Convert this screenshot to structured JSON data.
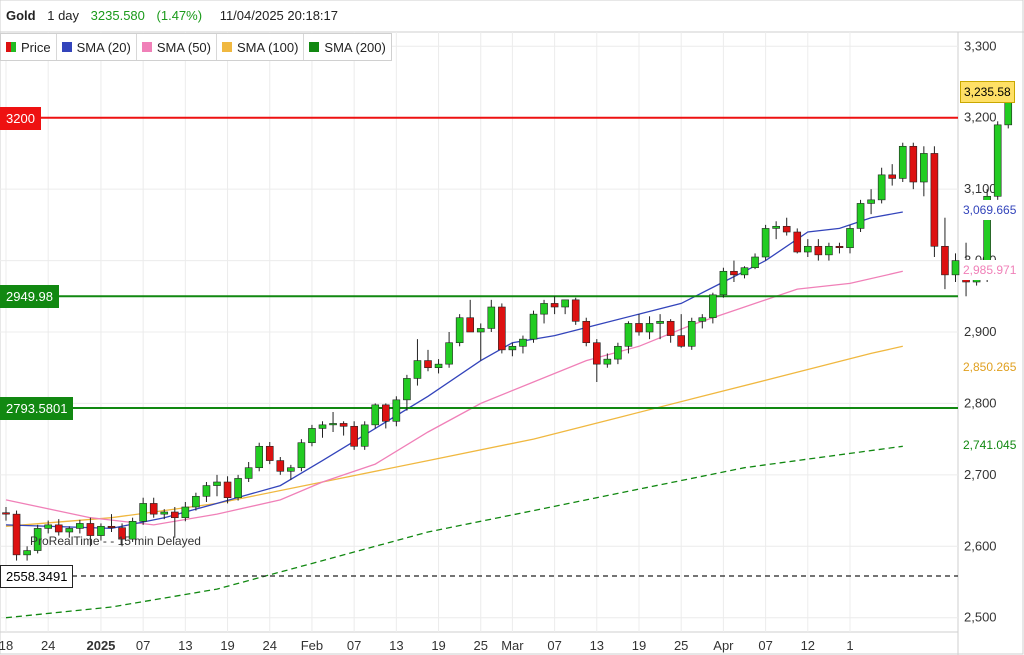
{
  "header": {
    "symbol": "Gold",
    "timeframe": "1 day",
    "price": "3235.580",
    "change": "(1.47%)",
    "datetime": "11/04/2025 20:18:17"
  },
  "legend": [
    {
      "label": "Price",
      "color": "#22bb22"
    },
    {
      "label": "SMA (20)",
      "color": "#3344bb"
    },
    {
      "label": "SMA (50)",
      "color": "#f080b8"
    },
    {
      "label": "SMA (100)",
      "color": "#f0b840"
    },
    {
      "label": "SMA (200)",
      "color": "#118811"
    }
  ],
  "footer_note": "ProRealTime -     - 15 min Delayed",
  "chart_data": {
    "type": "candlestick",
    "title": "Gold",
    "y_range": [
      2480,
      3320
    ],
    "y_ticks": [
      "2,500",
      "2,600",
      "2,700",
      "2,800",
      "2,900",
      "3,000",
      "3,100",
      "3,200",
      "3,300"
    ],
    "y_tick_values": [
      2500,
      2600,
      2700,
      2800,
      2900,
      3000,
      3100,
      3200,
      3300
    ],
    "x_tick_labels": [
      "18",
      "24",
      "2025",
      "07",
      "13",
      "19",
      "24",
      "Feb",
      "07",
      "13",
      "19",
      "25",
      "Mar",
      "07",
      "13",
      "19",
      "25",
      "Apr",
      "07",
      "12",
      "1"
    ],
    "x_tick_index": [
      0,
      4,
      9,
      13,
      17,
      21,
      25,
      29,
      33,
      37,
      41,
      45,
      48,
      52,
      56,
      60,
      64,
      68,
      72,
      76,
      80
    ],
    "candles": [
      [
        2647,
        2655,
        2636,
        2645
      ],
      [
        2645,
        2650,
        2580,
        2588
      ],
      [
        2588,
        2600,
        2580,
        2594
      ],
      [
        2594,
        2630,
        2590,
        2625
      ],
      [
        2625,
        2636,
        2618,
        2630
      ],
      [
        2630,
        2638,
        2615,
        2620
      ],
      [
        2620,
        2628,
        2612,
        2625
      ],
      [
        2625,
        2637,
        2618,
        2632
      ],
      [
        2632,
        2640,
        2600,
        2615
      ],
      [
        2615,
        2632,
        2608,
        2628
      ],
      [
        2628,
        2645,
        2620,
        2626
      ],
      [
        2626,
        2632,
        2600,
        2610
      ],
      [
        2610,
        2640,
        2606,
        2635
      ],
      [
        2635,
        2668,
        2630,
        2660
      ],
      [
        2660,
        2668,
        2640,
        2645
      ],
      [
        2645,
        2652,
        2638,
        2648
      ],
      [
        2648,
        2655,
        2612,
        2640
      ],
      [
        2640,
        2662,
        2635,
        2655
      ],
      [
        2655,
        2675,
        2650,
        2670
      ],
      [
        2670,
        2690,
        2662,
        2685
      ],
      [
        2685,
        2700,
        2670,
        2690
      ],
      [
        2690,
        2698,
        2660,
        2668
      ],
      [
        2668,
        2700,
        2664,
        2695
      ],
      [
        2695,
        2718,
        2690,
        2710
      ],
      [
        2710,
        2745,
        2705,
        2740
      ],
      [
        2740,
        2746,
        2715,
        2720
      ],
      [
        2720,
        2725,
        2700,
        2705
      ],
      [
        2705,
        2714,
        2693,
        2710
      ],
      [
        2710,
        2750,
        2705,
        2745
      ],
      [
        2745,
        2770,
        2740,
        2765
      ],
      [
        2765,
        2775,
        2752,
        2770
      ],
      [
        2770,
        2788,
        2760,
        2772
      ],
      [
        2772,
        2775,
        2755,
        2768
      ],
      [
        2768,
        2775,
        2735,
        2740
      ],
      [
        2740,
        2775,
        2735,
        2770
      ],
      [
        2770,
        2800,
        2765,
        2798
      ],
      [
        2798,
        2800,
        2765,
        2775
      ],
      [
        2775,
        2810,
        2768,
        2805
      ],
      [
        2805,
        2840,
        2790,
        2835
      ],
      [
        2835,
        2890,
        2825,
        2860
      ],
      [
        2860,
        2875,
        2845,
        2850
      ],
      [
        2850,
        2862,
        2842,
        2855
      ],
      [
        2855,
        2900,
        2850,
        2885
      ],
      [
        2885,
        2925,
        2880,
        2920
      ],
      [
        2920,
        2945,
        2910,
        2900
      ],
      [
        2900,
        2912,
        2860,
        2905
      ],
      [
        2905,
        2945,
        2900,
        2935
      ],
      [
        2935,
        2940,
        2870,
        2875
      ],
      [
        2875,
        2885,
        2866,
        2880
      ],
      [
        2880,
        2895,
        2870,
        2890
      ],
      [
        2890,
        2930,
        2885,
        2925
      ],
      [
        2925,
        2945,
        2912,
        2940
      ],
      [
        2940,
        2950,
        2925,
        2935
      ],
      [
        2935,
        2945,
        2925,
        2945
      ],
      [
        2945,
        2948,
        2910,
        2915
      ],
      [
        2915,
        2920,
        2880,
        2885
      ],
      [
        2885,
        2890,
        2830,
        2855
      ],
      [
        2855,
        2870,
        2850,
        2862
      ],
      [
        2862,
        2885,
        2855,
        2880
      ],
      [
        2880,
        2915,
        2870,
        2912
      ],
      [
        2912,
        2925,
        2895,
        2900
      ],
      [
        2900,
        2922,
        2890,
        2912
      ],
      [
        2912,
        2925,
        2890,
        2915
      ],
      [
        2915,
        2918,
        2885,
        2895
      ],
      [
        2895,
        2925,
        2878,
        2880
      ],
      [
        2880,
        2920,
        2875,
        2915
      ],
      [
        2915,
        2925,
        2905,
        2920
      ],
      [
        2920,
        2955,
        2912,
        2952
      ],
      [
        2952,
        2990,
        2948,
        2985
      ],
      [
        2985,
        3000,
        2970,
        2980
      ],
      [
        2980,
        2992,
        2975,
        2990
      ],
      [
        2990,
        3010,
        2988,
        3005
      ],
      [
        3005,
        3050,
        3000,
        3045
      ],
      [
        3045,
        3055,
        3030,
        3048
      ],
      [
        3048,
        3060,
        3035,
        3040
      ],
      [
        3040,
        3045,
        3010,
        3012
      ],
      [
        3012,
        3030,
        3005,
        3020
      ],
      [
        3020,
        3030,
        3000,
        3008
      ],
      [
        3008,
        3025,
        3000,
        3020
      ],
      [
        3020,
        3025,
        3010,
        3018
      ],
      [
        3018,
        3050,
        3010,
        3045
      ],
      [
        3045,
        3085,
        3040,
        3080
      ],
      [
        3080,
        3100,
        3065,
        3085
      ],
      [
        3085,
        3130,
        3080,
        3120
      ],
      [
        3120,
        3135,
        3105,
        3115
      ],
      [
        3115,
        3165,
        3110,
        3160
      ],
      [
        3160,
        3165,
        3100,
        3110
      ],
      [
        3110,
        3160,
        3090,
        3150
      ],
      [
        3150,
        3160,
        3005,
        3020
      ],
      [
        3020,
        3060,
        2960,
        2980
      ],
      [
        2980,
        3010,
        2970,
        3000
      ],
      [
        3000,
        3025,
        2950,
        2970
      ],
      [
        2970,
        3000,
        2965,
        2975
      ],
      [
        2975,
        3100,
        2970,
        3090
      ],
      [
        3090,
        3195,
        3085,
        3190
      ],
      [
        3190,
        3245,
        3185,
        3235
      ]
    ],
    "sma20": [
      [
        0,
        2630
      ],
      [
        10,
        2625
      ],
      [
        15,
        2640
      ],
      [
        20,
        2660
      ],
      [
        26,
        2685
      ],
      [
        30,
        2720
      ],
      [
        35,
        2765
      ],
      [
        40,
        2810
      ],
      [
        45,
        2860
      ],
      [
        48,
        2885
      ],
      [
        52,
        2895
      ],
      [
        56,
        2910
      ],
      [
        60,
        2925
      ],
      [
        64,
        2940
      ],
      [
        68,
        2970
      ],
      [
        72,
        3000
      ],
      [
        76,
        3040
      ],
      [
        79,
        3045
      ],
      [
        82,
        3060
      ],
      [
        85,
        3068
      ]
    ],
    "sma50": [
      [
        0,
        2665
      ],
      [
        8,
        2640
      ],
      [
        14,
        2630
      ],
      [
        20,
        2645
      ],
      [
        26,
        2665
      ],
      [
        30,
        2690
      ],
      [
        35,
        2715
      ],
      [
        40,
        2760
      ],
      [
        45,
        2800
      ],
      [
        50,
        2830
      ],
      [
        55,
        2860
      ],
      [
        60,
        2880
      ],
      [
        65,
        2910
      ],
      [
        70,
        2935
      ],
      [
        75,
        2960
      ],
      [
        80,
        2968
      ],
      [
        85,
        2985
      ]
    ],
    "sma100": [
      [
        0,
        2628
      ],
      [
        10,
        2640
      ],
      [
        20,
        2660
      ],
      [
        30,
        2690
      ],
      [
        40,
        2720
      ],
      [
        50,
        2750
      ],
      [
        58,
        2780
      ],
      [
        66,
        2810
      ],
      [
        74,
        2840
      ],
      [
        82,
        2870
      ],
      [
        85,
        2880
      ]
    ],
    "sma200": [
      [
        0,
        2500
      ],
      [
        10,
        2515
      ],
      [
        20,
        2540
      ],
      [
        30,
        2580
      ],
      [
        40,
        2620
      ],
      [
        50,
        2650
      ],
      [
        60,
        2680
      ],
      [
        70,
        2710
      ],
      [
        80,
        2730
      ],
      [
        85,
        2740
      ]
    ],
    "levels": [
      {
        "value": 3200,
        "label": "3200",
        "color": "#ee1111",
        "style": "solid",
        "side": "left",
        "label_text_color": "#ffffff"
      },
      {
        "value": 2949.98,
        "label": "2949.98",
        "color": "#118811",
        "style": "solid",
        "side": "left",
        "label_text_color": "#ffffff"
      },
      {
        "value": 2793.5801,
        "label": "2793.5801",
        "color": "#118811",
        "style": "solid",
        "side": "left",
        "label_text_color": "#ffffff"
      },
      {
        "value": 2558.3491,
        "label": "2558.3491",
        "color": "#222222",
        "style": "dashed",
        "side": "left",
        "label_text_color": "#000000"
      }
    ],
    "right_labels": [
      {
        "value": 3235.58,
        "label": "3,235.58",
        "bg": "#ffe066",
        "fg": "#000000"
      },
      {
        "value": 3069.665,
        "label": "3,069.665",
        "bg": "#ffffff",
        "fg": "#3344bb"
      },
      {
        "value": 2985.971,
        "label": "2,985.971",
        "bg": "#ffffff",
        "fg": "#f080b8"
      },
      {
        "value": 2850.265,
        "label": "2,850.265",
        "bg": "#ffffff",
        "fg": "#e0a020"
      },
      {
        "value": 2741.045,
        "label": "2,741.045",
        "bg": "#ffffff",
        "fg": "#118811"
      }
    ],
    "colors": {
      "up": "#22cc22",
      "down": "#dd1111",
      "sma20": "#3344bb",
      "sma50": "#f080b8",
      "sma100": "#f0b840",
      "sma200": "#118811",
      "grid": "#ececec"
    }
  }
}
